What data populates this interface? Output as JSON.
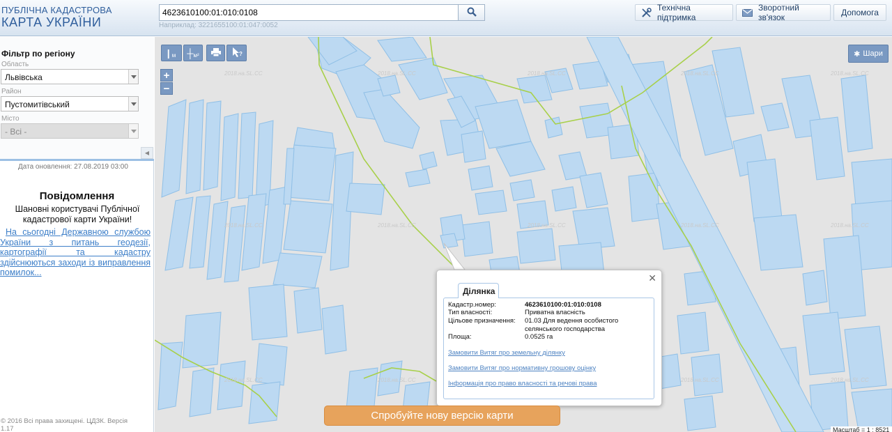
{
  "header": {
    "logo_line1": "ПУБЛІЧНА КАДАСТРОВА",
    "logo_line2": "КАРТА УКРАЇНИ",
    "search_value": "4623610100:01:010:0108",
    "search_hint": "Наприклад: 3221655100:01:047:0052",
    "support_label": "Технічна підтримка",
    "feedback_label": "Зворотний зв'язок",
    "help_label": "Допомога",
    "icons": {
      "search": "search-icon",
      "support": "tools-icon",
      "feedback": "envelope-icon"
    }
  },
  "sidebar": {
    "filter_title": "Фільтр по регіону",
    "oblast_label": "Область",
    "oblast_value": "Львівська",
    "rayon_label": "Район",
    "rayon_value": "Пустомитівський",
    "misto_label": "Місто",
    "misto_value": "- Всі -",
    "update_date": "Дата оновлення: 27.08.2019 03:00",
    "notice_title": "Повідомлення",
    "notice_greeting": "Шановні користувачі Публічної кадастрової карти України!",
    "notice_link": "На сьогодні Державною службою України з питань геодезії, картографії та кадастру здійснюються заходи із виправлення помилок...",
    "copyright": "© 2016 Всі права захищені. ЦДЗК. Версія 1.17"
  },
  "map": {
    "toolbar": {
      "measure_m": "м",
      "measure_m2": "м²",
      "layers_label": "Шари"
    },
    "watermark": "2018.на.SL.CC",
    "scale_label": "Масштаб = 1 : 8521",
    "colors": {
      "parcel_fill": "#bcd9f2",
      "parcel_stroke": "#8fbfe6",
      "boundary": "#a8d04a",
      "background": "#e4e4e4"
    }
  },
  "popup": {
    "tab_label": "Ділянка",
    "rows": [
      {
        "key": "Кадастр.номер:",
        "value": "4623610100:01:010:0108"
      },
      {
        "key": "Тип власності:",
        "value": "Приватна власність"
      },
      {
        "key": "Цільове призначення:",
        "value": "01.03 Для ведення особистого селянського господарства"
      },
      {
        "key": "Площа:",
        "value": "0.0525 га"
      }
    ],
    "links": [
      "Замовити Витяг про земельну ділянку",
      "Замовити Витяг про нормативну грошову оцінку",
      "Інформація про право власності та речові права"
    ]
  },
  "new_version_button": "Спробуйте нову версію карти"
}
